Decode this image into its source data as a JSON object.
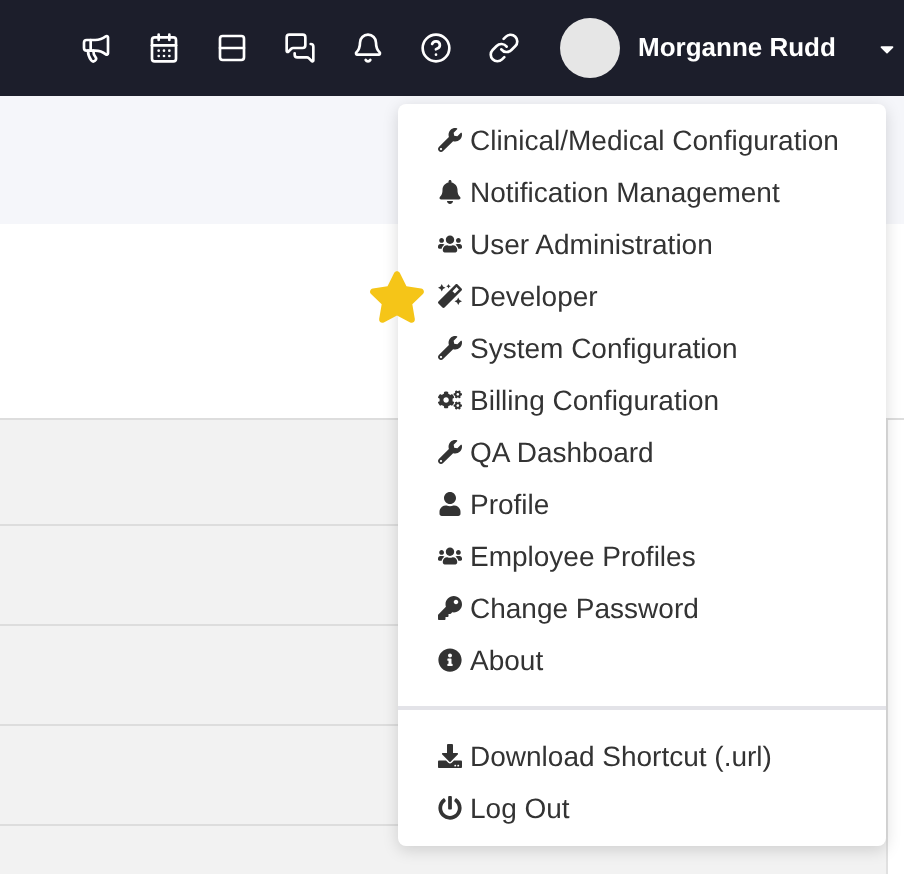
{
  "header": {
    "user_name": "Morganne Rudd"
  },
  "user_menu": {
    "sections": [
      [
        {
          "label": "Clinical/Medical Configuration"
        },
        {
          "label": "Notification Management"
        },
        {
          "label": "User Administration"
        },
        {
          "label": "Developer"
        },
        {
          "label": "System Configuration"
        },
        {
          "label": "Billing Configuration"
        },
        {
          "label": "QA Dashboard"
        },
        {
          "label": "Profile"
        },
        {
          "label": "Employee Profiles"
        },
        {
          "label": "Change Password"
        },
        {
          "label": "About"
        }
      ],
      [
        {
          "label": "Download Shortcut (.url)"
        },
        {
          "label": "Log Out"
        }
      ]
    ]
  }
}
